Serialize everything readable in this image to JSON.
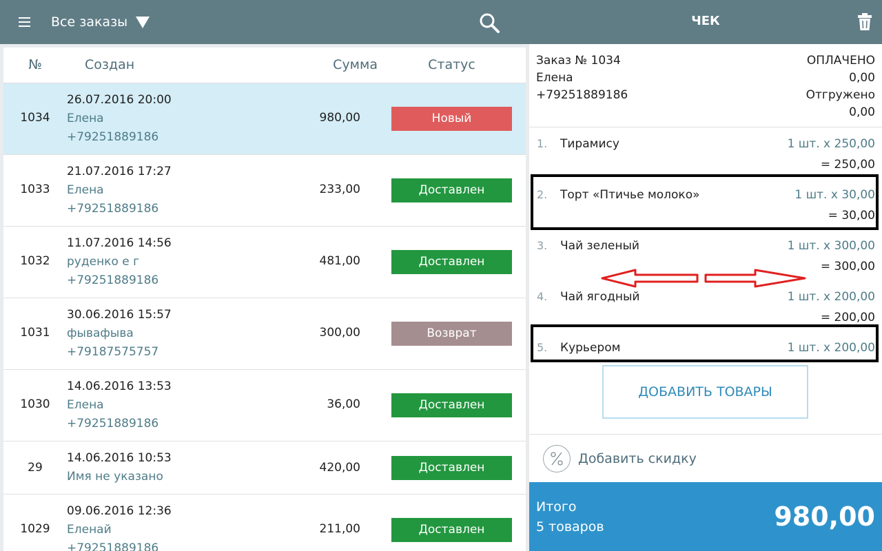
{
  "topbar": {
    "filter_label": "Все заказы",
    "receipt_title": "ЧЕК",
    "icons": [
      "menu-icon",
      "caret-down-icon",
      "search-icon",
      "trash-icon"
    ]
  },
  "orders": {
    "headers": {
      "num": "№",
      "created": "Создан",
      "sum": "Сумма",
      "status": "Статус"
    },
    "rows": [
      {
        "num": "1034",
        "date": "26.07.2016 20:00",
        "name": "Елена",
        "phone": "+79251889186",
        "sum": "980,00",
        "status": "Новый",
        "status_color": "#e05c5c",
        "selected": true
      },
      {
        "num": "1033",
        "date": "21.07.2016 17:27",
        "name": "Елена",
        "phone": "+79251889186",
        "sum": "233,00",
        "status": "Доставлен",
        "status_color": "#22973f"
      },
      {
        "num": "1032",
        "date": "11.07.2016 14:56",
        "name": "руденко е г",
        "phone": "+79251889186",
        "sum": "481,00",
        "status": "Доставлен",
        "status_color": "#22973f"
      },
      {
        "num": "1031",
        "date": "30.06.2016 15:57",
        "name": "фывафыва",
        "phone": "+79187575757",
        "sum": "300,00",
        "status": "Возврат",
        "status_color": "#a58e90"
      },
      {
        "num": "1030",
        "date": "14.06.2016 13:53",
        "name": "Елена",
        "phone": "+79251889186",
        "sum": "36,00",
        "status": "Доставлен",
        "status_color": "#22973f"
      },
      {
        "num": "29",
        "date": "14.06.2016 10:53",
        "name": "Имя не указано",
        "phone": "",
        "sum": "420,00",
        "status": "Доставлен",
        "status_color": "#22973f"
      },
      {
        "num": "1029",
        "date": "09.06.2016 12:36",
        "name": "Еленай",
        "phone": "+79251889186",
        "sum": "211,00",
        "status": "Доставлен",
        "status_color": "#22973f"
      }
    ]
  },
  "receipt": {
    "order_label": "Заказ № 1034",
    "customer_name": "Елена",
    "customer_phone": "+79251889186",
    "paid_label": "ОПЛАЧЕНО",
    "paid_amount": "0,00",
    "shipped_label": "Отгружено",
    "shipped_amount": "0,00",
    "items": [
      {
        "num": "1.",
        "name": "Тирамису",
        "qty": "1 шт. x 250,00",
        "total": "= 250,00"
      },
      {
        "num": "2.",
        "name": "Торт «Птичье молоко»",
        "qty": "1 шт. x 30,00",
        "total": "= 30,00"
      },
      {
        "num": "3.",
        "name": "Чай зеленый",
        "qty": "1 шт. x 300,00",
        "total": "= 300,00"
      },
      {
        "num": "4.",
        "name": "Чай ягодный",
        "qty": "1 шт. x 200,00",
        "total": "= 200,00"
      },
      {
        "num": "5.",
        "name": "Курьером",
        "qty": "1 шт. x 200,00",
        "total": ""
      }
    ],
    "add_goods_label": "ДОБАВИТЬ ТОВАРЫ",
    "discount_label": "Добавить скидку",
    "total_label": "Итого",
    "total_count": "5 товаров",
    "total_sum": "980,00",
    "accent_color": "#2e93cc",
    "annotation_color": "#e0201f"
  }
}
